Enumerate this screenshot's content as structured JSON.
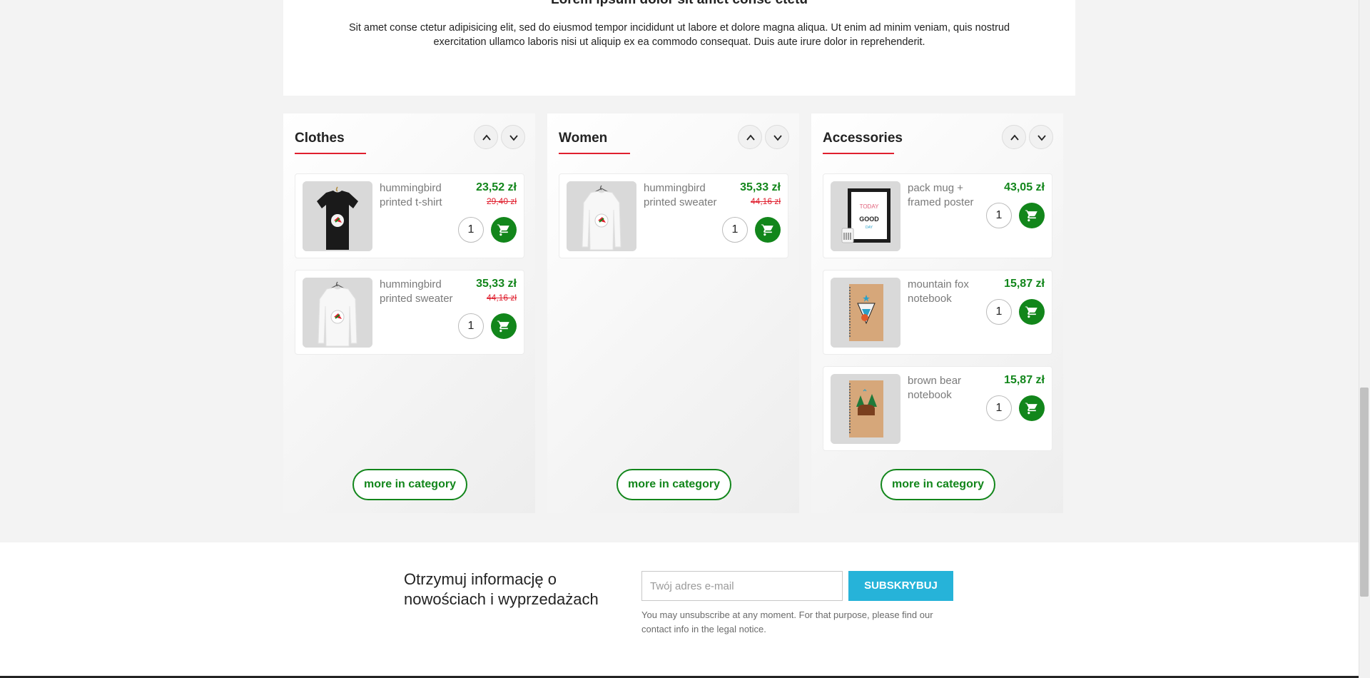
{
  "intro": {
    "heading": "Lorem ipsum dolor sit amet conse ctetu",
    "text": "Sit amet conse ctetur adipisicing elit, sed do eiusmod tempor incididunt ut labore et dolore magna aliqua. Ut enim ad minim veniam, quis nostrud exercitation ullamco laboris nisi ut aliquip ex ea commodo consequat. Duis aute irure dolor in reprehenderit."
  },
  "categories": [
    {
      "title": "Clothes",
      "more_label": "more in category",
      "products": [
        {
          "name": "hummingbird printed t-shirt",
          "price": "23,52 zł",
          "old_price": "29,40 zł",
          "qty": "1",
          "image": "black-tshirt"
        },
        {
          "name": "hummingbird printed sweater",
          "price": "35,33 zł",
          "old_price": "44,16 zł",
          "qty": "1",
          "image": "white-sweater"
        }
      ]
    },
    {
      "title": "Women",
      "more_label": "more in category",
      "products": [
        {
          "name": "hummingbird printed sweater",
          "price": "35,33 zł",
          "old_price": "44,16 zł",
          "qty": "1",
          "image": "white-sweater"
        }
      ]
    },
    {
      "title": "Accessories",
      "more_label": "more in category",
      "products": [
        {
          "name": "pack mug + framed poster",
          "price": "43,05 zł",
          "qty": "1",
          "image": "framed-poster"
        },
        {
          "name": "mountain fox notebook",
          "price": "15,87 zł",
          "qty": "1",
          "image": "fox-notebook"
        },
        {
          "name": "brown bear notebook",
          "price": "15,87 zł",
          "qty": "1",
          "image": "bear-notebook"
        }
      ]
    }
  ],
  "poster": {
    "line1": "TODAY",
    "line2": "GOOD",
    "line3": "DAY"
  },
  "newsletter": {
    "title": "Otrzymuj informację o nowościach i wyprzedażach",
    "placeholder": "Twój adres e-mail",
    "button": "SUBSKRYBUJ",
    "note": "You may unsubscribe at any moment. For that purpose, please find our contact info in the legal notice."
  },
  "colors": {
    "price": "#12861b",
    "old_price": "#e0202f",
    "accent": "#e0202f",
    "subscribe": "#26b3d9"
  }
}
